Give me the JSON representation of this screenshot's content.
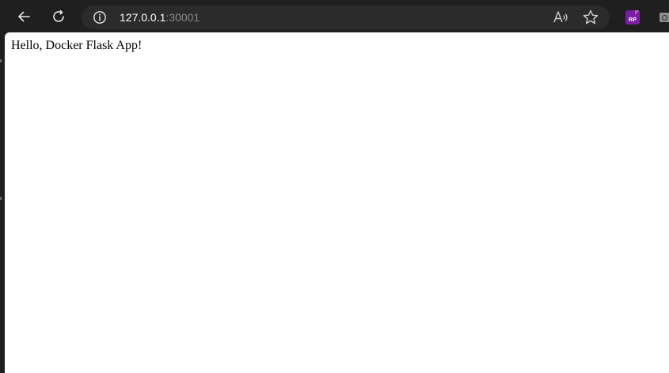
{
  "browser": {
    "address_bar": {
      "host": "127.0.0.1",
      "port": ":30001"
    },
    "toolbar": {
      "back_icon": "back-arrow-icon",
      "refresh_icon": "refresh-icon",
      "site_info_icon": "info-icon",
      "read_aloud_icon": "read-aloud-icon",
      "favorite_icon": "star-icon"
    },
    "extensions": [
      {
        "name": "rp-extension",
        "label": "RP",
        "color": "#7b1fa2"
      },
      {
        "name": "extension-icon",
        "color": "#8e8e8e"
      }
    ]
  },
  "page": {
    "body_text": "Hello, Docker Flask App!"
  }
}
